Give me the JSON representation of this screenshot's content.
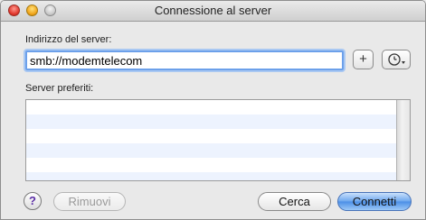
{
  "window": {
    "title": "Connessione al server"
  },
  "server_address": {
    "label": "Indirizzo del server:",
    "value": "smb://modemtelecom",
    "add_button_label": "+",
    "history_icon": "clock-dropdown-icon"
  },
  "favorites": {
    "label": "Server preferiti:",
    "items": []
  },
  "footer": {
    "help_label": "?",
    "remove_label": "Rimuovi",
    "browse_label": "Cerca",
    "connect_label": "Connetti"
  },
  "colors": {
    "focus_ring": "#6ca0ea",
    "default_button": "#4a8ee6",
    "list_alt_row": "#edf3fe"
  }
}
